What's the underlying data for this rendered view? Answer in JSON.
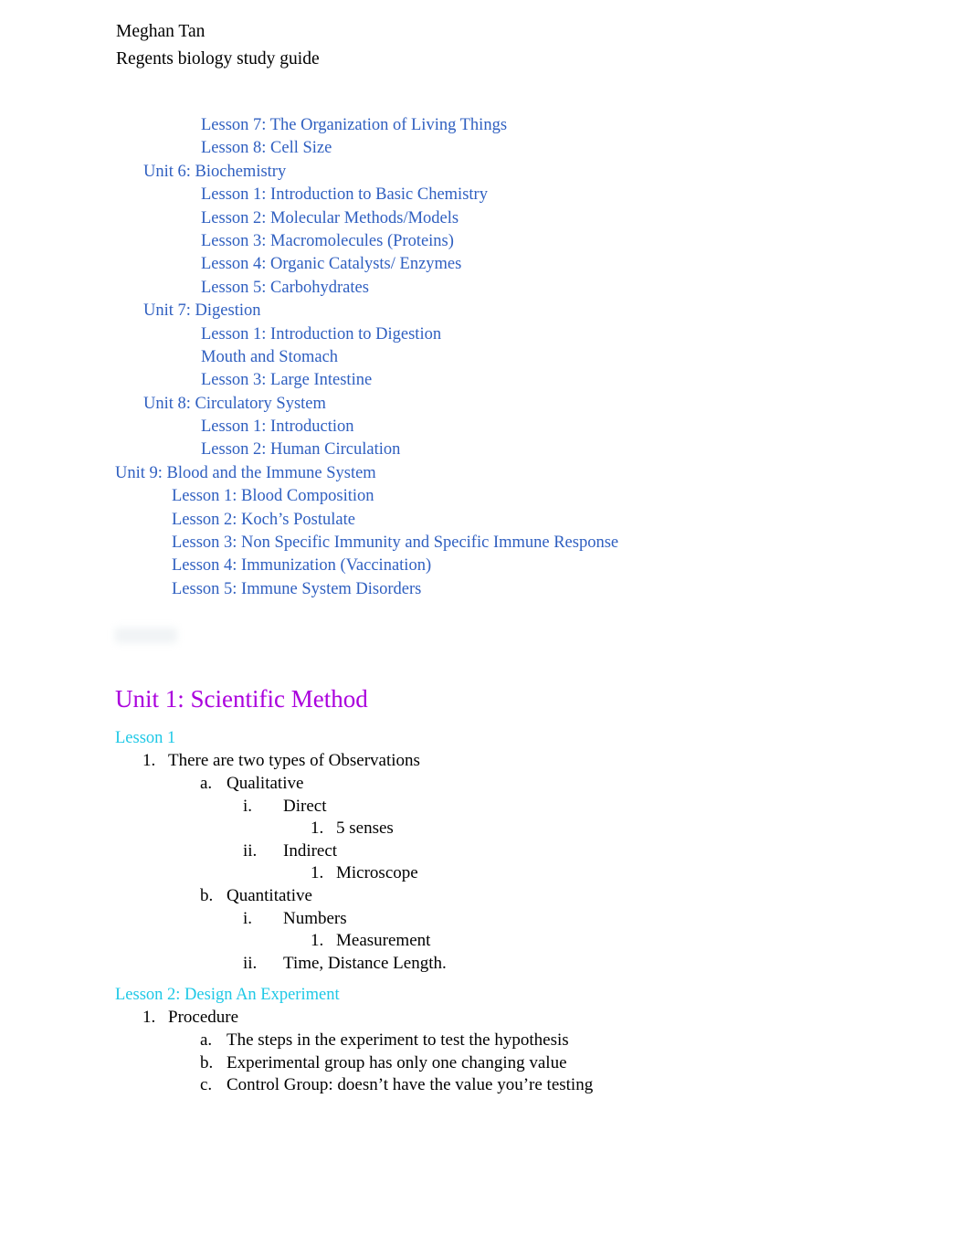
{
  "document": {
    "author": "Meghan Tan",
    "subtitle": "Regents biology study guide"
  },
  "colors": {
    "link_blue": "#2f5fc0",
    "unit_heading": "#aa00dd",
    "lesson_heading": "#1ec8e6",
    "body_text": "#000000",
    "page_background": "#ffffff"
  },
  "toc": {
    "entries": [
      {
        "text": "Lesson 7: The Organization of Living Things",
        "level": "lesson"
      },
      {
        "text": "Lesson 8: Cell Size",
        "level": "lesson"
      },
      {
        "text": "Unit 6: Biochemistry",
        "level": "unit"
      },
      {
        "text": "Lesson 1: Introduction to Basic Chemistry",
        "level": "lesson"
      },
      {
        "text": "Lesson 2: Molecular Methods/Models",
        "level": "lesson"
      },
      {
        "text": "Lesson 3: Macromolecules (Proteins)",
        "level": "lesson"
      },
      {
        "text": "Lesson 4: Organic Catalysts/ Enzymes",
        "level": "lesson"
      },
      {
        "text": "Lesson 5: Carbohydrates",
        "level": "lesson"
      },
      {
        "text": "Unit 7: Digestion",
        "level": "unit"
      },
      {
        "text": "Lesson 1: Introduction to Digestion",
        "level": "lesson"
      },
      {
        "text": "Mouth and Stomach",
        "level": "lesson"
      },
      {
        "text": "Lesson 3: Large Intestine",
        "level": "lesson"
      },
      {
        "text": "Unit 8: Circulatory System",
        "level": "unit"
      },
      {
        "text": "Lesson 1: Introduction",
        "level": "lesson"
      },
      {
        "text": "Lesson 2: Human Circulation",
        "level": "lesson"
      },
      {
        "text": "Unit 9: Blood and the Immune System",
        "level": "unit-out"
      },
      {
        "text": "Lesson 1: Blood Composition",
        "level": "lesson-out"
      },
      {
        "text": "Lesson 2: Koch’s Postulate",
        "level": "lesson-out"
      },
      {
        "text": "Lesson 3: Non Specific Immunity and Specific Immune Response",
        "level": "lesson-out"
      },
      {
        "text": "Lesson 4: Immunization (Vaccination)",
        "level": "lesson-out"
      },
      {
        "text": "Lesson 5: Immune System Disorders",
        "level": "lesson-out"
      }
    ]
  },
  "unit_heading": "Unit 1: Scientific Method",
  "lessons": [
    {
      "title": "Lesson 1",
      "outline": [
        {
          "marker": "1.",
          "text": "There are two types of Observations",
          "level": 1
        },
        {
          "marker": "a.",
          "text": "Qualitative",
          "level": 2
        },
        {
          "marker": "i.",
          "text": "Direct",
          "level": 3
        },
        {
          "marker": "1.",
          "text": "5 senses",
          "level": 4
        },
        {
          "marker": "ii.",
          "text": "Indirect",
          "level": 3
        },
        {
          "marker": "1.",
          "text": "Microscope",
          "level": 4
        },
        {
          "marker": "b.",
          "text": "Quantitative",
          "level": 2
        },
        {
          "marker": "i.",
          "text": "Numbers",
          "level": 3
        },
        {
          "marker": "1.",
          "text": "Measurement",
          "level": 4
        },
        {
          "marker": "ii.",
          "text": "Time, Distance Length.",
          "level": 3
        }
      ]
    },
    {
      "title": "Lesson 2: Design An Experiment",
      "outline": [
        {
          "marker": "1.",
          "text": "Procedure",
          "level": 1
        },
        {
          "marker": "a.",
          "text": "The steps in the experiment to test the hypothesis",
          "level": 2
        },
        {
          "marker": "b.",
          "text": "Experimental group has only one changing value",
          "level": 2
        },
        {
          "marker": "c.",
          "text": "Control Group: doesn’t have the value you’re testing",
          "level": 2
        }
      ]
    }
  ]
}
